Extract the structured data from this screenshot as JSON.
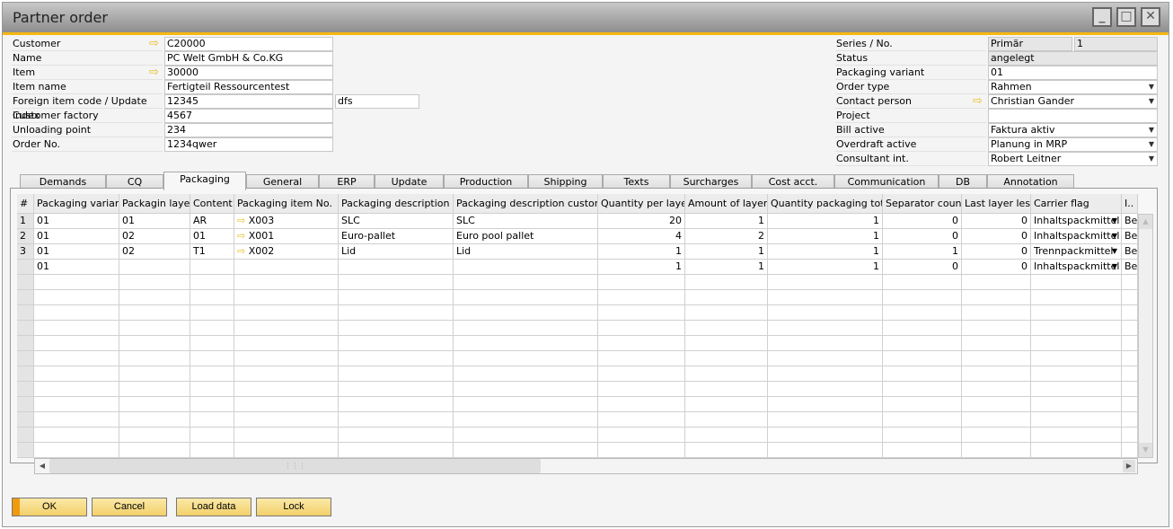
{
  "window": {
    "title": "Partner order",
    "controls": [
      "minimize",
      "maximize",
      "close"
    ]
  },
  "left_form": [
    {
      "label": "Customer",
      "value": "C20000",
      "link": true
    },
    {
      "label": "Name",
      "value": "PC Welt GmbH & Co.KG"
    },
    {
      "label": "Item",
      "value": "30000",
      "link": true
    },
    {
      "label": "Item name",
      "value": "Fertigteil Ressourcentest"
    },
    {
      "label": "Foreign item code / Update index",
      "value": "12345",
      "value2": "dfs"
    },
    {
      "label": "Customer factory",
      "value": "4567"
    },
    {
      "label": "Unloading point",
      "value": "234"
    },
    {
      "label": "Order No.",
      "value": "1234qwer"
    }
  ],
  "right_form": [
    {
      "label": "Series / No.",
      "value": "Primär",
      "value2": "1",
      "readonly": true
    },
    {
      "label": "Status",
      "value": "angelegt",
      "readonly": true
    },
    {
      "label": "Packaging variant",
      "value": "01"
    },
    {
      "label": "Order type",
      "value": "Rahmen",
      "dropdown": true
    },
    {
      "label": "Contact person",
      "value": "Christian Gander",
      "dropdown": true,
      "link": true
    },
    {
      "label": "Project",
      "value": ""
    },
    {
      "label": "Bill active",
      "value": "Faktura aktiv",
      "dropdown": true
    },
    {
      "label": "Overdraft active",
      "value": "Planung in MRP",
      "dropdown": true
    },
    {
      "label": "Consultant int.",
      "value": "Robert Leitner",
      "dropdown": true
    }
  ],
  "tabs": [
    "Demands",
    "CQ",
    "Packaging",
    "General",
    "ERP",
    "Update",
    "Production",
    "Shipping",
    "Texts",
    "Surcharges",
    "Cost acct.",
    "Communication",
    "DB",
    "Annotation"
  ],
  "active_tab": "Packaging",
  "grid": {
    "columns": [
      "#",
      "Packaging variant",
      "Packagin layer",
      "Content",
      "Packaging item No.",
      "Packaging description",
      "Packaging description customer",
      "Quantity per layer",
      "Amount of layers",
      "Quantity packaging total",
      "Separator count",
      "Last layer less",
      "Carrier flag",
      "I.."
    ],
    "rows": [
      [
        "1",
        "01",
        "01",
        "AR",
        "X003",
        "SLC",
        "SLC",
        "20",
        "1",
        "1",
        "0",
        "0",
        "Inhaltspackmittel",
        "Bes"
      ],
      [
        "2",
        "01",
        "02",
        "01",
        "X001",
        "Euro-pallet",
        "Euro pool pallet",
        "4",
        "2",
        "1",
        "0",
        "0",
        "Inhaltspackmittel",
        "Bes"
      ],
      [
        "3",
        "01",
        "02",
        "T1",
        "X002",
        "Lid",
        "Lid",
        "1",
        "1",
        "1",
        "1",
        "0",
        "Trennpackmittel",
        "Bes"
      ],
      [
        "",
        "01",
        "",
        "",
        "",
        "",
        "",
        "1",
        "1",
        "1",
        "0",
        "0",
        "Inhaltspackmittel",
        "Bes"
      ]
    ]
  },
  "buttons": {
    "ok": "OK",
    "cancel": "Cancel",
    "load": "Load data",
    "lock": "Lock"
  },
  "colors": {
    "accent": "#f7b712",
    "button": "#f3d06a",
    "link_arrow": "#e8c020"
  }
}
